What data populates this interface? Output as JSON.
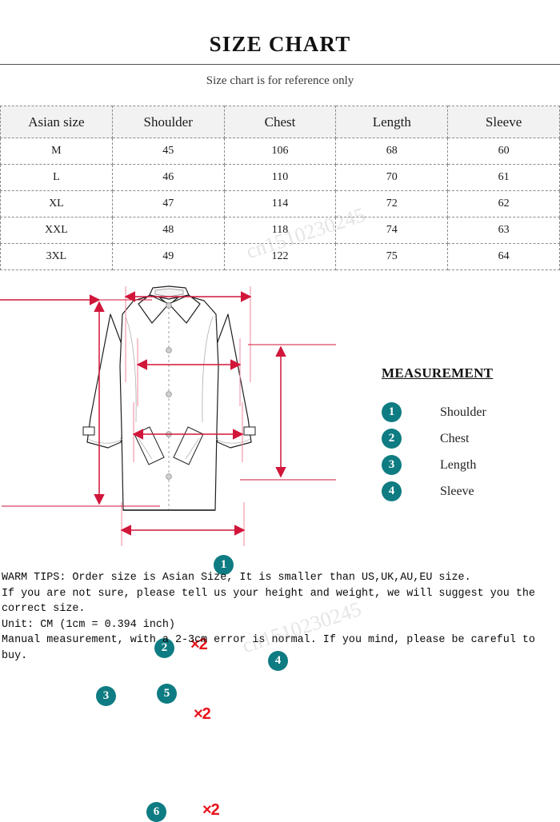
{
  "header": {
    "title": "SIZE CHART",
    "subtitle": "Size chart is for reference only"
  },
  "table": {
    "columns": [
      "Asian size",
      "Shoulder",
      "Chest",
      "Length",
      "Sleeve"
    ],
    "rows": [
      {
        "size": "M",
        "shoulder": "45",
        "chest": "106",
        "length": "68",
        "sleeve": "60"
      },
      {
        "size": "L",
        "shoulder": "46",
        "chest": "110",
        "length": "70",
        "sleeve": "61"
      },
      {
        "size": "XL",
        "shoulder": "47",
        "chest": "114",
        "length": "72",
        "sleeve": "62"
      },
      {
        "size": "XXL",
        "shoulder": "48",
        "chest": "118",
        "length": "74",
        "sleeve": "63"
      },
      {
        "size": "3XL",
        "shoulder": "49",
        "chest": "122",
        "length": "75",
        "sleeve": "64"
      }
    ]
  },
  "diagram": {
    "badges": [
      "1",
      "2",
      "3",
      "4",
      "5",
      "6"
    ],
    "multiplier_labels": [
      "×2",
      "×2",
      "×2"
    ],
    "arrow_color": "#d1163a",
    "multiplier_color": "#e8121a",
    "badge_color": "#0e7c82"
  },
  "legend": {
    "title": "MEASUREMENT",
    "items": [
      {
        "num": "1",
        "label": "Shoulder"
      },
      {
        "num": "2",
        "label": "Chest"
      },
      {
        "num": "3",
        "label": "Length"
      },
      {
        "num": "4",
        "label": "Sleeve"
      }
    ]
  },
  "tips": {
    "text": "WARM TIPS: Order size is Asian Size, It is smaller than US,UK,AU,EU size.\nIf you are not sure, please tell us your height and weight, we will suggest you the\ncorrect size.\nUnit: CM (1cm = 0.394 inch)\nManual measurement, with a 2-3cm error is normal. If you mind, please be careful to\nbuy."
  },
  "watermark": {
    "text": "cn1510230245"
  }
}
